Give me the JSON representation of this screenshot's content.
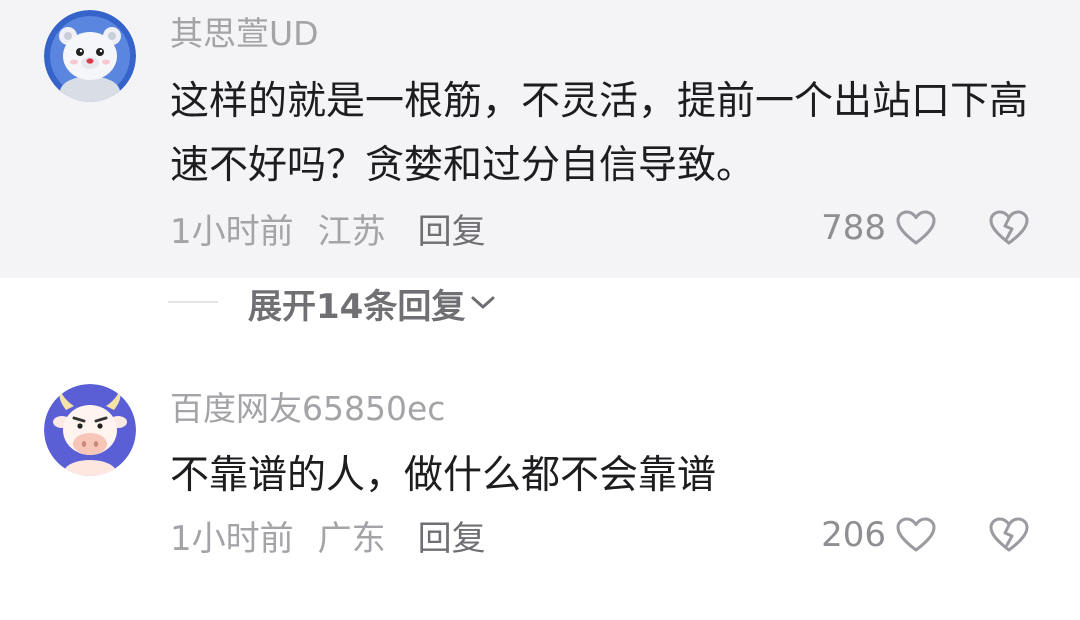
{
  "comments": [
    {
      "username": "其思萱UD",
      "text": "这样的就是一根筋，不灵活，提前一个出站口下高速不好吗？贪婪和过分自信导致。",
      "time": "1小时前",
      "region": "江苏",
      "reply_label": "回复",
      "likes": "788",
      "avatar": "polar-bear-astronaut"
    },
    {
      "username": "百度网友65850ec",
      "text": "不靠谱的人，做什么都不会靠谱",
      "time": "1小时前",
      "region": "广东",
      "reply_label": "回复",
      "likes": "206",
      "avatar": "cartoon-cow"
    }
  ],
  "expand_replies": {
    "label": "展开14条回复",
    "icon": "chevron-down-icon"
  },
  "colors": {
    "highlight_bg": "#f4f4f6",
    "username": "#a3a3a8",
    "body_text": "#1d1d1f",
    "meta_text": "#a3a3a8",
    "accent_avatar_bg": "#5b5fd6"
  }
}
